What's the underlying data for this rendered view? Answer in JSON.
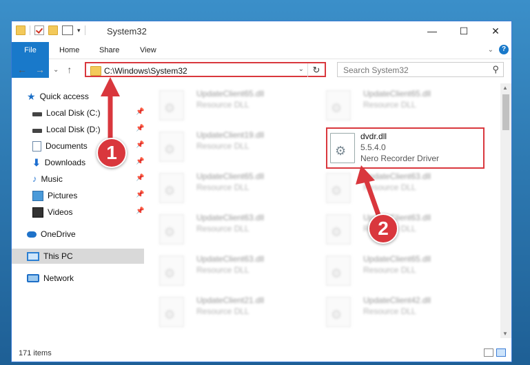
{
  "window": {
    "title": "System32",
    "controls": {
      "minimize": "—",
      "maximize": "☐",
      "close": "✕"
    }
  },
  "ribbon": {
    "tabs": [
      "File",
      "Home",
      "Share",
      "View"
    ],
    "expand_icon": "chevron-down-icon",
    "help_label": "?"
  },
  "navigation": {
    "back": "←",
    "forward": "→",
    "recent": "⌄",
    "up": "↑",
    "address": "C:\\Windows\\System32",
    "refresh": "↻",
    "search_placeholder": "Search System32"
  },
  "sidebar": {
    "items": [
      {
        "label": "Quick access",
        "icon": "star-icon",
        "pinned": false
      },
      {
        "label": "Local Disk (C:)",
        "icon": "disk-icon",
        "pinned": true
      },
      {
        "label": "Local Disk (D:)",
        "icon": "disk-icon",
        "pinned": true
      },
      {
        "label": "Documents",
        "icon": "document-icon",
        "pinned": true
      },
      {
        "label": "Downloads",
        "icon": "download-icon",
        "pinned": true
      },
      {
        "label": "Music",
        "icon": "music-icon",
        "pinned": true
      },
      {
        "label": "Pictures",
        "icon": "picture-icon",
        "pinned": true
      },
      {
        "label": "Videos",
        "icon": "video-icon",
        "pinned": true
      },
      {
        "label": "OneDrive",
        "icon": "cloud-icon",
        "pinned": false
      },
      {
        "label": "This PC",
        "icon": "computer-icon",
        "pinned": false,
        "selected": true
      },
      {
        "label": "Network",
        "icon": "network-icon",
        "pinned": false
      }
    ]
  },
  "files": [
    {
      "name": "UpdateClient65.dll",
      "desc": "Resource DLL"
    },
    {
      "name": "UpdateClient65.dll",
      "desc": "Resource DLL"
    },
    {
      "name": "UpdateClient19.dll",
      "desc": "Resource DLL"
    },
    {
      "name": "dvdr.dll",
      "version": "5.5.4.0",
      "desc": "Nero Recorder Driver",
      "highlighted": true
    },
    {
      "name": "UpdateClient65.dll",
      "desc": "Resource DLL"
    },
    {
      "name": "UpdateClient63.dll",
      "desc": "Resource DLL"
    },
    {
      "name": "UpdateClient63.dll",
      "desc": "Resource DLL"
    },
    {
      "name": "UpdateClient63.dll",
      "desc": "Resource DLL"
    },
    {
      "name": "UpdateClient63.dll",
      "desc": "Resource DLL"
    },
    {
      "name": "UpdateClient65.dll",
      "desc": "Resource DLL"
    },
    {
      "name": "UpdateClient21.dll",
      "desc": "Resource DLL"
    },
    {
      "name": "UpdateClient42.dll",
      "desc": "Resource DLL"
    }
  ],
  "status": {
    "item_count": "171 items"
  },
  "annotations": {
    "callout1": "1",
    "callout2": "2",
    "color": "#d9373d"
  },
  "colors": {
    "accent": "#1979ca",
    "highlight": "#d9373d"
  }
}
